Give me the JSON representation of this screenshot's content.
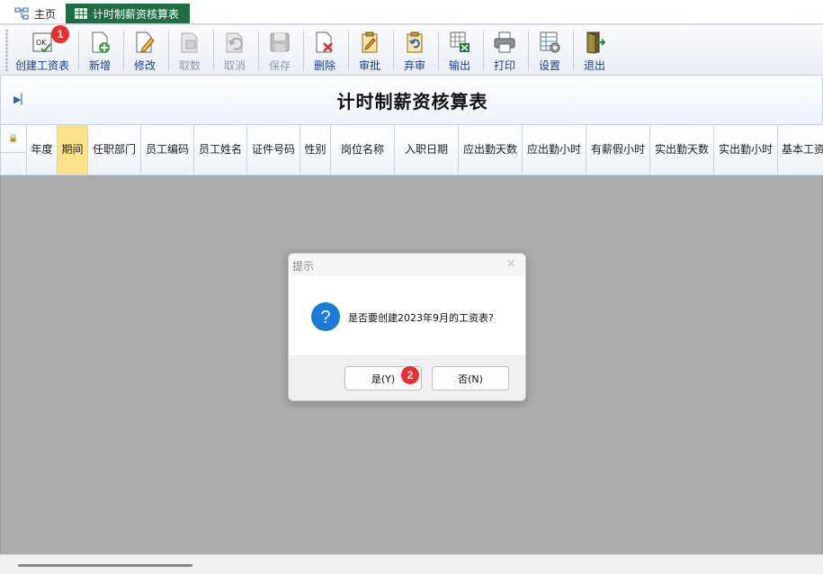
{
  "tabs": {
    "home": "主页",
    "active": "计时制薪资核算表"
  },
  "toolbar": {
    "items": [
      {
        "label": "创建工资表",
        "icon": "create-ok-icon",
        "disabled": false
      },
      {
        "label": "新增",
        "icon": "add-doc-icon",
        "disabled": false
      },
      {
        "label": "修改",
        "icon": "edit-doc-icon",
        "disabled": false
      },
      {
        "label": "取数",
        "icon": "fetch-data-icon",
        "disabled": true
      },
      {
        "label": "取消",
        "icon": "undo-icon",
        "disabled": true
      },
      {
        "label": "保存",
        "icon": "save-icon",
        "disabled": true
      },
      {
        "label": "删除",
        "icon": "delete-doc-icon",
        "disabled": false
      },
      {
        "label": "审批",
        "icon": "approve-icon",
        "disabled": false
      },
      {
        "label": "弃审",
        "icon": "unapprove-icon",
        "disabled": false
      },
      {
        "label": "输出",
        "icon": "export-excel-icon",
        "disabled": false
      },
      {
        "label": "打印",
        "icon": "printer-icon",
        "disabled": false
      },
      {
        "label": "设置",
        "icon": "settings-icon",
        "disabled": false
      },
      {
        "label": "退出",
        "icon": "exit-door-icon",
        "disabled": false
      }
    ]
  },
  "badges": {
    "first": "1",
    "second": "2"
  },
  "page": {
    "title": "计时制薪资核算表"
  },
  "grid": {
    "columns": [
      "年度",
      "期间",
      "任职部门",
      "员工编码",
      "员工姓名",
      "证件号码",
      "性别",
      "岗位名称",
      "入职日期",
      "应出勤天数",
      "应出勤小时",
      "有薪假小时",
      "实出勤天数",
      "实出勤小时",
      "基本工资"
    ],
    "highlight_color": "#fde28a"
  },
  "dialog": {
    "title": "提示",
    "close": "×",
    "message": "是否要创建2023年9月的工资表?",
    "yes": "是(Y)",
    "no": "否(N)"
  },
  "colors": {
    "active_tab": "#1f6e43",
    "badge": "#e8302f",
    "toolbar_text": "#1a3d8f",
    "grid_background": "#acacac"
  }
}
